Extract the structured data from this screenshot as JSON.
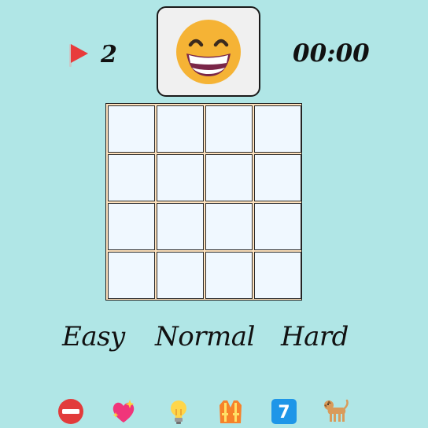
{
  "header": {
    "flags_remaining": "2",
    "timer": "00:00",
    "face_state": "beaming-grin"
  },
  "board": {
    "rows": 4,
    "cols": 4,
    "cells": [
      [
        "hidden",
        "hidden",
        "hidden",
        "hidden"
      ],
      [
        "hidden",
        "hidden",
        "hidden",
        "hidden"
      ],
      [
        "hidden",
        "hidden",
        "hidden",
        "hidden"
      ],
      [
        "hidden",
        "hidden",
        "hidden",
        "hidden"
      ]
    ]
  },
  "difficulty": {
    "easy": "Easy",
    "normal": "Normal",
    "hard": "Hard"
  },
  "toolbar": {
    "icons": [
      "no-entry-icon",
      "sparkling-heart-icon",
      "light-bulb-icon",
      "safety-vest-icon",
      "keycap-seven-icon",
      "dog-icon"
    ],
    "keycap_label": "7"
  },
  "colors": {
    "background": "#b0e6e6",
    "face_panel": "#f0f0f0",
    "board_frame": "#ffe2bd",
    "cell": "#f0f8ff",
    "flag": "#e83b3b"
  }
}
